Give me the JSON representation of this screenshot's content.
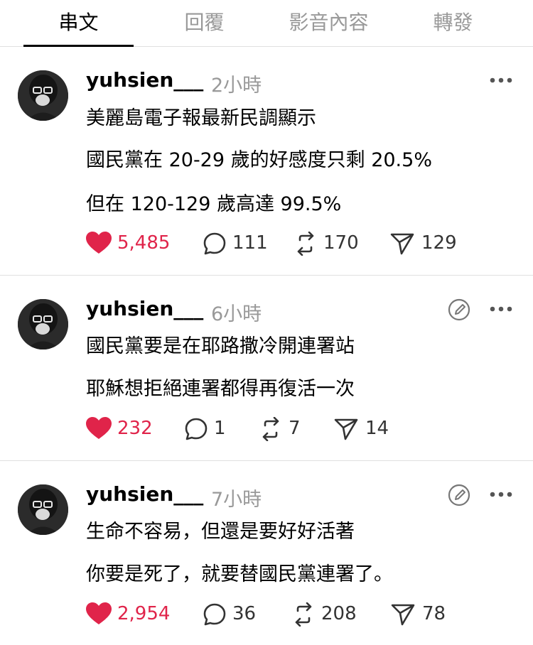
{
  "tabs": [
    {
      "label": "串文",
      "active": true
    },
    {
      "label": "回覆",
      "active": false
    },
    {
      "label": "影音內容",
      "active": false
    },
    {
      "label": "轉發",
      "active": false
    }
  ],
  "colors": {
    "like": "#e0244a",
    "muted": "#999999",
    "icon": "#333333"
  },
  "posts": [
    {
      "username": "yuhsien___",
      "time": "2小時",
      "lines": [
        "美麗島電子報最新民調顯示",
        "國民黨在 20-29 歲的好感度只剩 20.5%",
        "但在 120-129 歲高達 99.5%"
      ],
      "likes": "5,485",
      "comments": "111",
      "reposts": "170",
      "shares": "129",
      "icons": [
        "more-icon"
      ]
    },
    {
      "username": "yuhsien___",
      "time": "6小時",
      "lines": [
        "國民黨要是在耶路撒冷開連署站",
        "耶穌想拒絕連署都得再復活一次"
      ],
      "likes": "232",
      "comments": "1",
      "reposts": "7",
      "shares": "14",
      "icons": [
        "edit-icon",
        "more-icon"
      ]
    },
    {
      "username": "yuhsien___",
      "time": "7小時",
      "lines": [
        "生命不容易，但還是要好好活著",
        "你要是死了，就要替國民黨連署了。"
      ],
      "likes": "2,954",
      "comments": "36",
      "reposts": "208",
      "shares": "78",
      "icons": [
        "edit-icon",
        "more-icon"
      ]
    }
  ]
}
